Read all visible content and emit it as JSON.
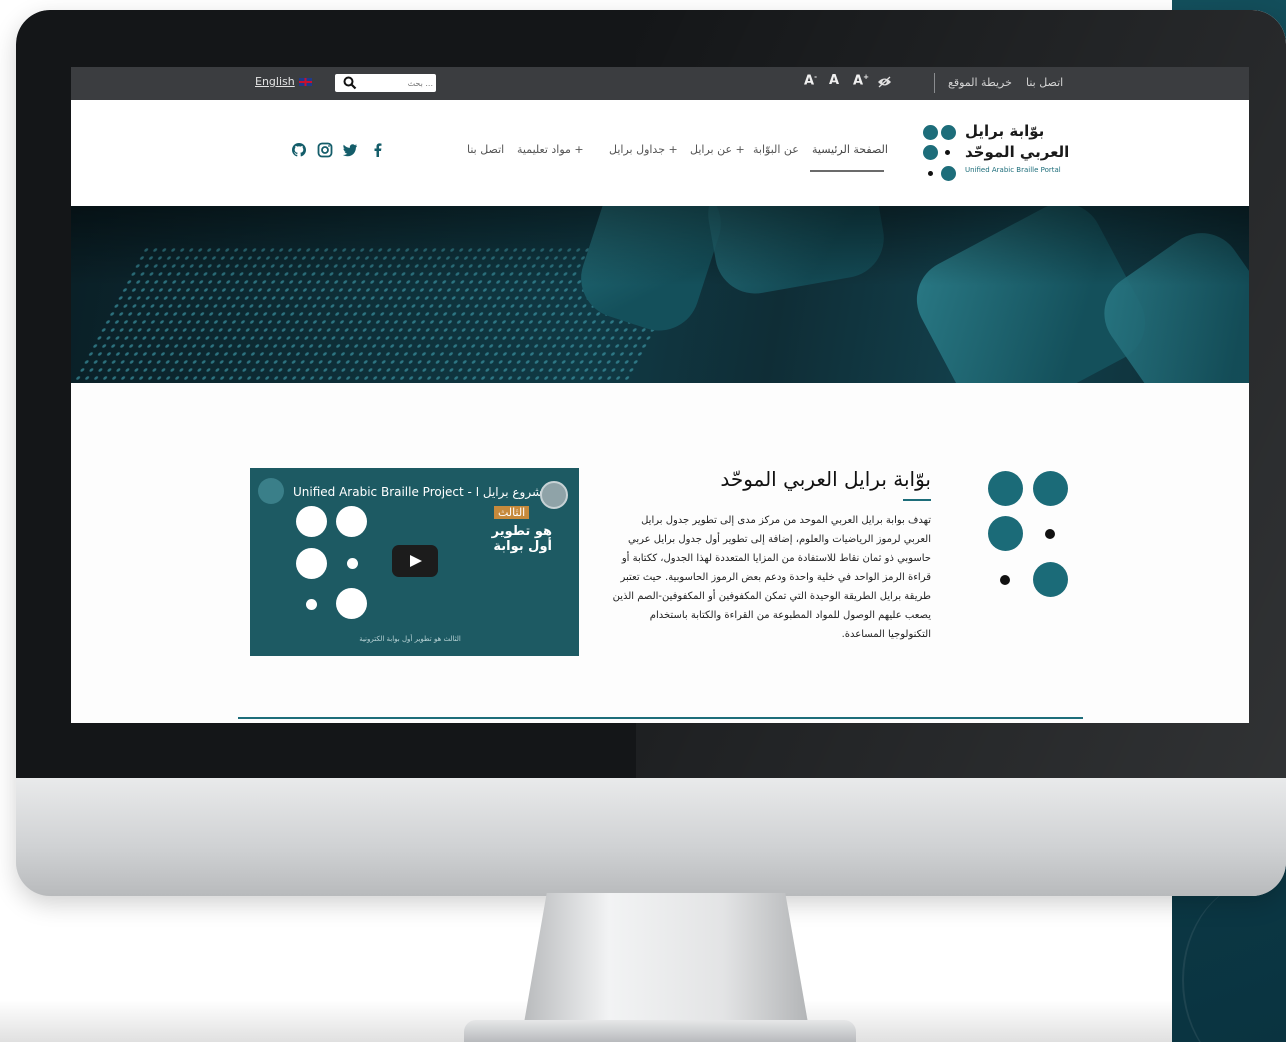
{
  "topbar": {
    "language_link": "English",
    "search_placeholder": "بحث ...",
    "font_decrease": "A",
    "font_normal": "A",
    "font_increase": "A",
    "links": [
      "اتصل بنا",
      "خريطة الموقع"
    ]
  },
  "header": {
    "logo_line1": "بوّابة برايل",
    "logo_line2": "العربي الموحّد",
    "logo_en": "Unified Arabic Braille Portal",
    "nav": [
      "الصفحة الرئيسية",
      "عن البوّابة",
      "عن برايل +",
      "جداول برايل +",
      "مواد تعليمية +",
      "اتصل بنا"
    ],
    "social_icons": [
      "facebook-icon",
      "twitter-icon",
      "instagram-icon",
      "github-icon"
    ]
  },
  "intro": {
    "title": "بوّابة برايل العربي الموحّد",
    "body": "تهدف بوابة برايل العربي الموحد من مركز مدى إلى تطوير جدول برايل العربي لرموز الرياضيات والعلوم، إضافة إلى تطوير أول جدول برايل عربي حاسوبي ذو ثمان نقاط للاستفادة من المزايا المتعددة لهذا الجدول، ككتابة أو قراءة الرمز الواحد في خلية واحدة ودعم بعض الرموز الحاسوبية. حيث تعتبر طريقة برايل الطريقة الوحيدة التي تمكن المكفوفين أو المكفوفين-الصم الذين يصعب عليهم الوصول للمواد المطبوعة من القراءة والكتابة باستخدام التكنولوجيا المساعدة."
  },
  "video": {
    "title": "Unified Arabic Braille Project - مشروع برايل ا...",
    "tag": "الثالث",
    "overlay_text": "هو تطوير أول بوابة",
    "caption": "الثالث هو تطوير أول بوابة الكترونية"
  },
  "colors": {
    "brand_teal": "#1d6d7a",
    "topbar_bg": "#3b3d40",
    "panel_teal": "#134f5c"
  }
}
